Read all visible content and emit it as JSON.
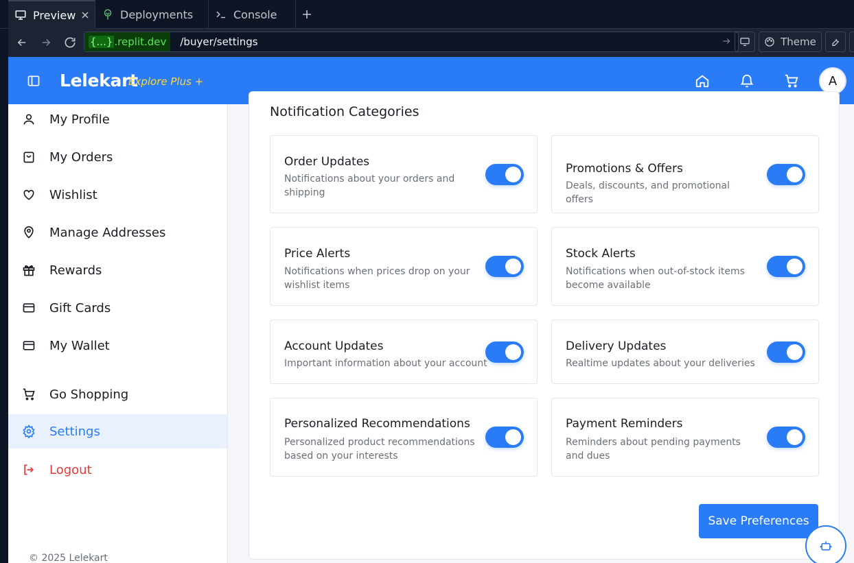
{
  "chrome": {
    "tabs": [
      {
        "label": "Preview",
        "icon": "monitor-icon",
        "active": true
      },
      {
        "label": "Deployments",
        "icon": "tree-icon"
      },
      {
        "label": "Console",
        "icon": "terminal-icon"
      }
    ],
    "url": {
      "host_prefix": "{...}",
      "host": ".replit.dev",
      "path": "/buyer/settings"
    },
    "theme_label": "Theme"
  },
  "header": {
    "brand": "Lelekart",
    "brand_sub": "Explore Plus +",
    "avatar_letter": "A"
  },
  "sidebar": {
    "items": [
      {
        "label": "My Profile",
        "icon": "user-icon"
      },
      {
        "label": "My Orders",
        "icon": "bag-icon"
      },
      {
        "label": "Wishlist",
        "icon": "heart-icon"
      },
      {
        "label": "Manage Addresses",
        "icon": "map-pin-icon"
      },
      {
        "label": "Rewards",
        "icon": "gift-icon"
      },
      {
        "label": "Gift Cards",
        "icon": "card-icon"
      },
      {
        "label": "My Wallet",
        "icon": "wallet-icon"
      },
      {
        "label": "Go Shopping",
        "icon": "cart-icon"
      },
      {
        "label": "Settings",
        "icon": "gear-icon",
        "active": true
      },
      {
        "label": "Logout",
        "icon": "logout-icon"
      }
    ],
    "copyright": "© 2025 Lelekart"
  },
  "main": {
    "section_title": "Notification Categories",
    "preferences": [
      {
        "title": "Order Updates",
        "desc": "Notifications about your orders and shipping",
        "enabled": true
      },
      {
        "title": "Promotions & Offers",
        "desc": "Deals, discounts, and promotional offers",
        "enabled": true
      },
      {
        "title": "Price Alerts",
        "desc": "Notifications when prices drop on your wishlist items",
        "enabled": true
      },
      {
        "title": "Stock Alerts",
        "desc": "Notifications when out-of-stock items become available",
        "enabled": true
      },
      {
        "title": "Account Updates",
        "desc": "Important information about your account",
        "enabled": true
      },
      {
        "title": "Delivery Updates",
        "desc": "Realtime updates about your deliveries",
        "enabled": true
      },
      {
        "title": "Personalized Recommendations",
        "desc": "Personalized product recommendations based on your interests",
        "enabled": true
      },
      {
        "title": "Payment Reminders",
        "desc": "Reminders about pending payments and dues",
        "enabled": true
      }
    ],
    "save_label": "Save Preferences"
  },
  "colors": {
    "primary": "#2a7cf6",
    "brand_sub": "#ffd83d",
    "logout": "#e5383b",
    "active_bg": "#e8f1fd"
  }
}
